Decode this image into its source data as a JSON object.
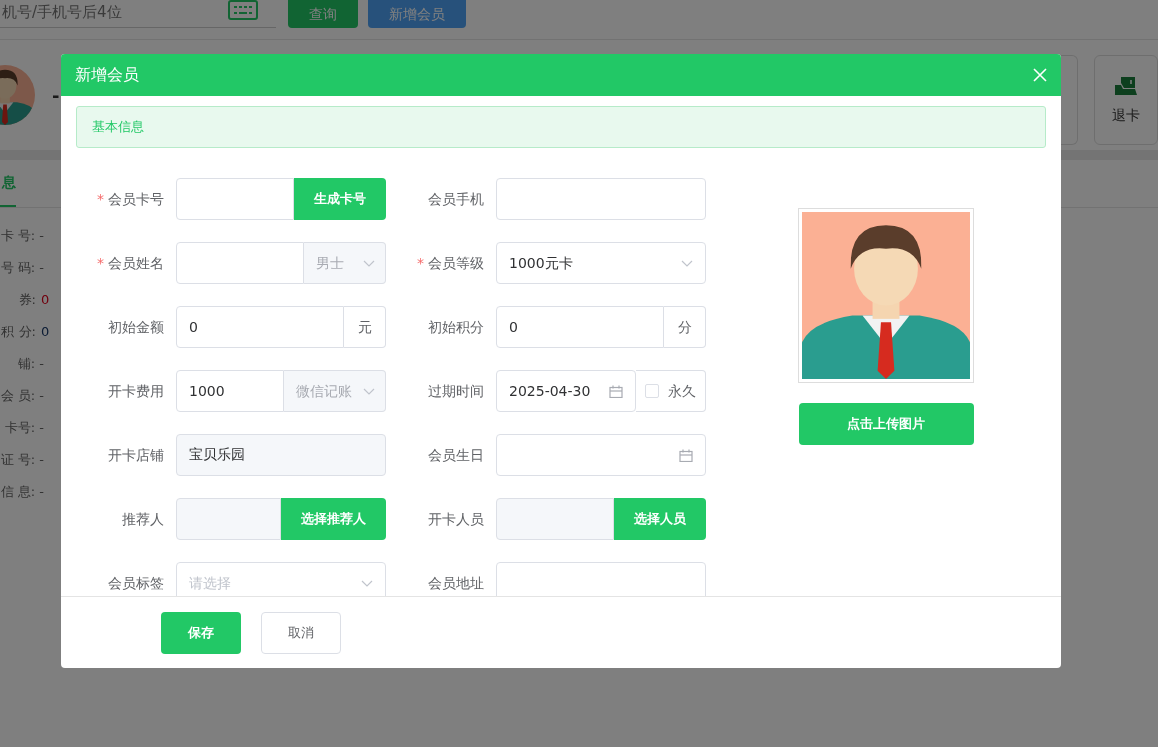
{
  "background": {
    "search": {
      "placeholder": "机号/手机号后4位"
    },
    "buttons": [
      {
        "label": "查询",
        "kind": "primary"
      },
      {
        "label": "新增会员",
        "kind": "info"
      }
    ],
    "member": {
      "name": "-"
    },
    "tab": "息",
    "info_rows": [
      {
        "text": "卡 号: -"
      },
      {
        "text": "号 码: -"
      },
      {
        "label": "券:",
        "value": "0",
        "kind": "alert"
      },
      {
        "label": "积 分:",
        "value": "0",
        "kind": "number"
      },
      {
        "text": "铺: -"
      },
      {
        "text": "会 员: -"
      },
      {
        "text": "卡号: -"
      },
      {
        "text": "证 号: -"
      },
      {
        "text": "信 息: -"
      }
    ],
    "side_action": "退卡"
  },
  "modal": {
    "title": "新增会员",
    "section_title": "基本信息",
    "rows": [
      {
        "fields": [
          {
            "label": "会员卡号",
            "required_mark": "*",
            "kind": "input-button",
            "button": "生成卡号"
          },
          {
            "label": "会员手机",
            "kind": "text"
          }
        ]
      },
      {
        "fields": [
          {
            "label": "会员姓名",
            "required_mark": "*",
            "kind": "input-select",
            "addon": "男士"
          },
          {
            "label": "会员等级",
            "required_mark": "*",
            "kind": "select",
            "value": "1000元卡"
          }
        ]
      },
      {
        "fields": [
          {
            "label": "初始金额",
            "kind": "input-unit",
            "value": "0",
            "unit": "元"
          },
          {
            "label": "初始积分",
            "kind": "input-unit",
            "value": "0",
            "unit": "分"
          }
        ]
      },
      {
        "fields": [
          {
            "label": "开卡费用",
            "kind": "input-select",
            "value": "1000",
            "addon": "微信记账"
          },
          {
            "label": "过期时间",
            "kind": "date",
            "value": "2025-04-30",
            "checkbox": {
              "label": "永久",
              "checked": false
            }
          }
        ]
      },
      {
        "fields": [
          {
            "label": "开卡店铺",
            "kind": "readonly-text",
            "value": "宝贝乐园"
          },
          {
            "label": "会员生日",
            "kind": "date"
          }
        ]
      },
      {
        "fields": [
          {
            "label": "推荐人",
            "kind": "picker-button",
            "button": "选择推荐人"
          },
          {
            "label": "开卡人员",
            "kind": "picker-button",
            "button": "选择人员"
          }
        ]
      },
      {
        "fields": [
          {
            "label": "会员标签",
            "kind": "select",
            "placeholder": "请选择"
          },
          {
            "label": "会员地址",
            "kind": "text"
          }
        ]
      }
    ],
    "upload_button": "点击上传图片",
    "buttons": [
      {
        "label": "保存",
        "kind": "primary"
      },
      {
        "label": "取消",
        "kind": "default"
      }
    ]
  }
}
